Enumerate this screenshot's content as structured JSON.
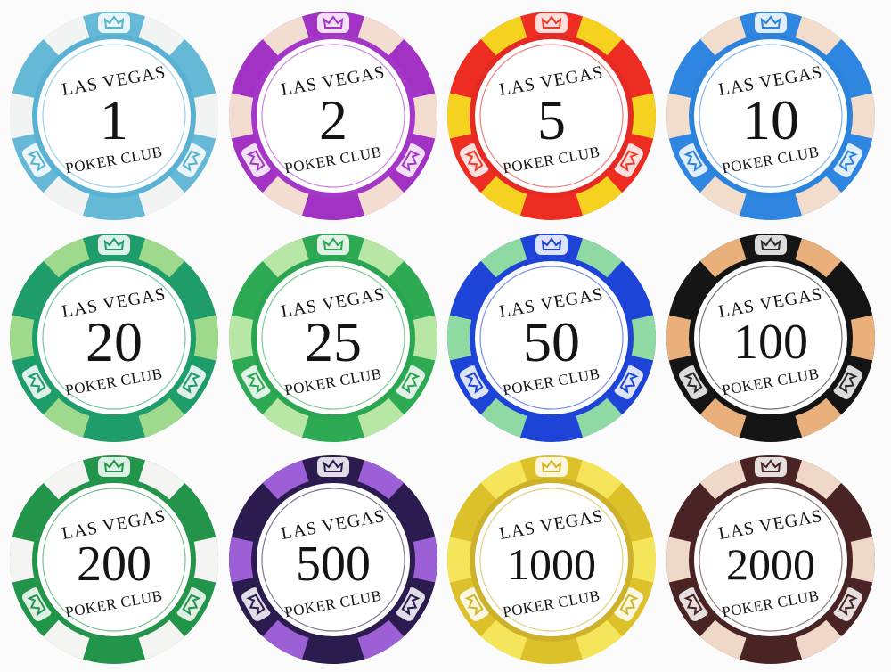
{
  "chips": [
    {
      "value": "1",
      "top_text": "LAS VEGAS",
      "bottom_text": "POKER CLUB",
      "body": "#66b9d6",
      "spot": "#f1f4f3",
      "ring": "#5ab2d3",
      "crown": "#5ab2d3"
    },
    {
      "value": "2",
      "top_text": "LAS VEGAS",
      "bottom_text": "POKER CLUB",
      "body": "#a132c4",
      "spot": "#f3ddd0",
      "ring": "#a436c8",
      "crown": "#a436c8"
    },
    {
      "value": "5",
      "top_text": "LAS VEGAS",
      "bottom_text": "POKER CLUB",
      "body": "#ee2d22",
      "spot": "#f5d21f",
      "ring": "#e52a24",
      "crown": "#ef3a2a"
    },
    {
      "value": "10",
      "top_text": "LAS VEGAS",
      "bottom_text": "POKER CLUB",
      "body": "#2f86e0",
      "spot": "#f2dccc",
      "ring": "#2b83dc",
      "crown": "#2b83dc"
    },
    {
      "value": "20",
      "top_text": "LAS VEGAS",
      "bottom_text": "POKER CLUB",
      "body": "#1e9c6a",
      "spot": "#9fd98c",
      "ring": "#1e9c6a",
      "crown": "#1e9c6a"
    },
    {
      "value": "25",
      "top_text": "LAS VEGAS",
      "bottom_text": "POKER CLUB",
      "body": "#2eaa55",
      "spot": "#b8e6a5",
      "ring": "#2aa552",
      "crown": "#2aa552"
    },
    {
      "value": "50",
      "top_text": "LAS VEGAS",
      "bottom_text": "POKER CLUB",
      "body": "#1d44d6",
      "spot": "#8fd9a3",
      "ring": "#1d44d6",
      "crown": "#1d44d6"
    },
    {
      "value": "100",
      "top_text": "LAS VEGAS",
      "bottom_text": "POKER CLUB",
      "body": "#151515",
      "spot": "#e9b07c",
      "ring": "#141414",
      "crown": "#2a2a2a"
    },
    {
      "value": "200",
      "top_text": "LAS VEGAS",
      "bottom_text": "POKER CLUB",
      "body": "#23954a",
      "spot": "#f4f4f2",
      "ring": "#23954a",
      "crown": "#23954a"
    },
    {
      "value": "500",
      "top_text": "LAS VEGAS",
      "bottom_text": "POKER CLUB",
      "body": "#2b1b4f",
      "spot": "#9c5fd6",
      "ring": "#2b1b4f",
      "crown": "#2b1b4f"
    },
    {
      "value": "1000",
      "top_text": "LAS VEGAS",
      "bottom_text": "POKER CLUB",
      "body": "#dcc12a",
      "spot": "#f4e55a",
      "ring": "#cdb128",
      "crown": "#d3b72a"
    },
    {
      "value": "2000",
      "top_text": "LAS VEGAS",
      "bottom_text": "POKER CLUB",
      "body": "#4a2424",
      "spot": "#f0d8c8",
      "ring": "#4a2424",
      "crown": "#4a2424"
    }
  ]
}
